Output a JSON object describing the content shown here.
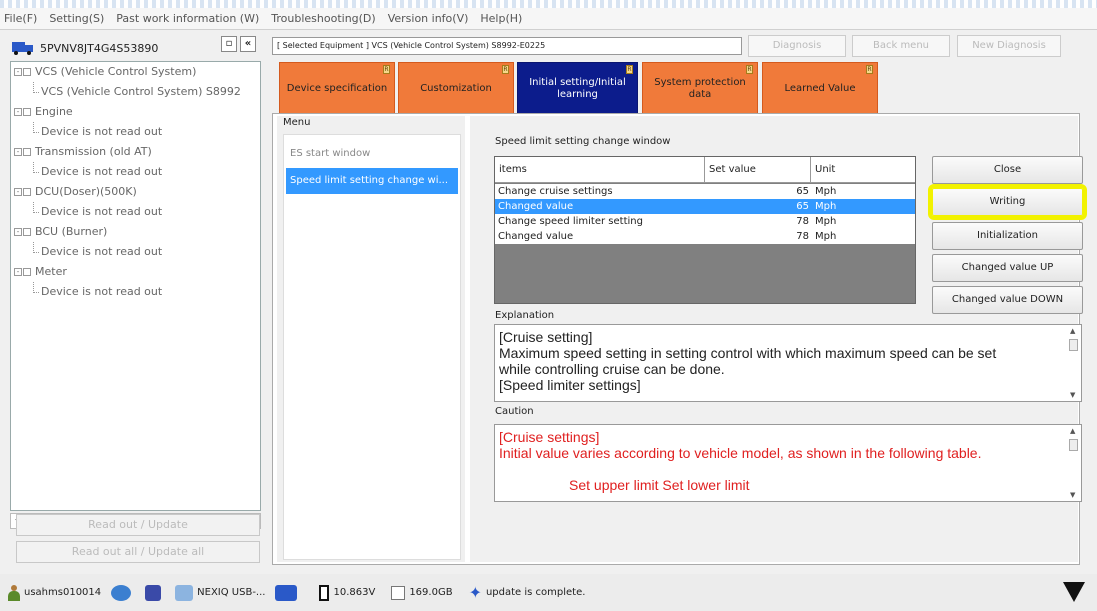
{
  "menubar": {
    "items": [
      "File(F)",
      "Setting(S)",
      "Past work information (W)",
      "Troubleshooting(D)",
      "Version info(V)",
      "Help(H)"
    ]
  },
  "left_panel": {
    "vin": "5PVNV8JT4G4S53890",
    "collapse_btn": "«",
    "pin_btn": "▫",
    "tree": [
      {
        "level": 0,
        "label": "VCS (Vehicle Control System)"
      },
      {
        "level": 1,
        "label": "VCS (Vehicle Control System) S8992"
      },
      {
        "level": 0,
        "label": "Engine"
      },
      {
        "level": 1,
        "label": "Device is not read out"
      },
      {
        "level": 0,
        "label": "Transmission (old AT)"
      },
      {
        "level": 1,
        "label": "Device is not read out"
      },
      {
        "level": 0,
        "label": "DCU(Doser)(500K)"
      },
      {
        "level": 1,
        "label": "Device is not read out"
      },
      {
        "level": 0,
        "label": "BCU (Burner)"
      },
      {
        "level": 1,
        "label": "Device is not read out"
      },
      {
        "level": 0,
        "label": "Meter"
      },
      {
        "level": 1,
        "label": "Device is not read out"
      }
    ],
    "read_out_btn": "Read out / Update",
    "read_out_all_btn": "Read out all / Update all"
  },
  "header": {
    "selected_equipment": "[ Selected Equipment ] VCS (Vehicle Control System) S8992-E0225",
    "diagnosis_btn": "Diagnosis",
    "back_menu_btn": "Back menu",
    "new_diagnosis_btn": "New Diagnosis"
  },
  "tabs": [
    {
      "label": "Device specification",
      "active": false
    },
    {
      "label": "Customization",
      "active": false
    },
    {
      "label": "Initial setting/Initial learning",
      "active": true
    },
    {
      "label": "System protection data",
      "active": false
    },
    {
      "label": "Learned Value",
      "active": false
    }
  ],
  "menu": {
    "title": "Menu",
    "items": [
      "ES start window",
      "Speed limit setting change wi..."
    ],
    "selected_index": 1
  },
  "window": {
    "title": "Speed limit setting change window",
    "columns": [
      "items",
      "Set value",
      "Unit"
    ],
    "rows": [
      {
        "item": "Change cruise settings",
        "value": "65",
        "unit": "Mph"
      },
      {
        "item": "Changed value",
        "value": "65",
        "unit": "Mph"
      },
      {
        "item": "Change speed limiter setting",
        "value": "78",
        "unit": "Mph"
      },
      {
        "item": "Changed value",
        "value": "78",
        "unit": "Mph"
      }
    ],
    "selected_row": 1,
    "buttons": {
      "close": "Close",
      "writing": "Writing",
      "initialization": "Initialization",
      "up": "Changed value UP",
      "down": "Changed value DOWN"
    },
    "explanation_label": "Explanation",
    "explanation_lines": [
      "[Cruise setting]",
      "Maximum speed setting in setting control with which maximum speed can be set",
      "while controlling cruise can be done.",
      "[Speed limiter settings]"
    ],
    "caution_label": "Caution",
    "caution_lines": [
      "[Cruise settings]",
      "Initial value varies according to vehicle model, as shown in the following table.",
      "",
      "Set upper limit  Set lower limit"
    ]
  },
  "taskbar": {
    "user": "usahms010014",
    "usb": "NEXIQ USB-...",
    "voltage": "10.863V",
    "disk": "169.0GB",
    "status": "update is complete."
  },
  "colors": {
    "tab_orange": "#f07a3a",
    "tab_active": "#0c1c8c",
    "selection": "#3399ff",
    "highlight": "#f2f200",
    "caution_text": "#e02020"
  }
}
